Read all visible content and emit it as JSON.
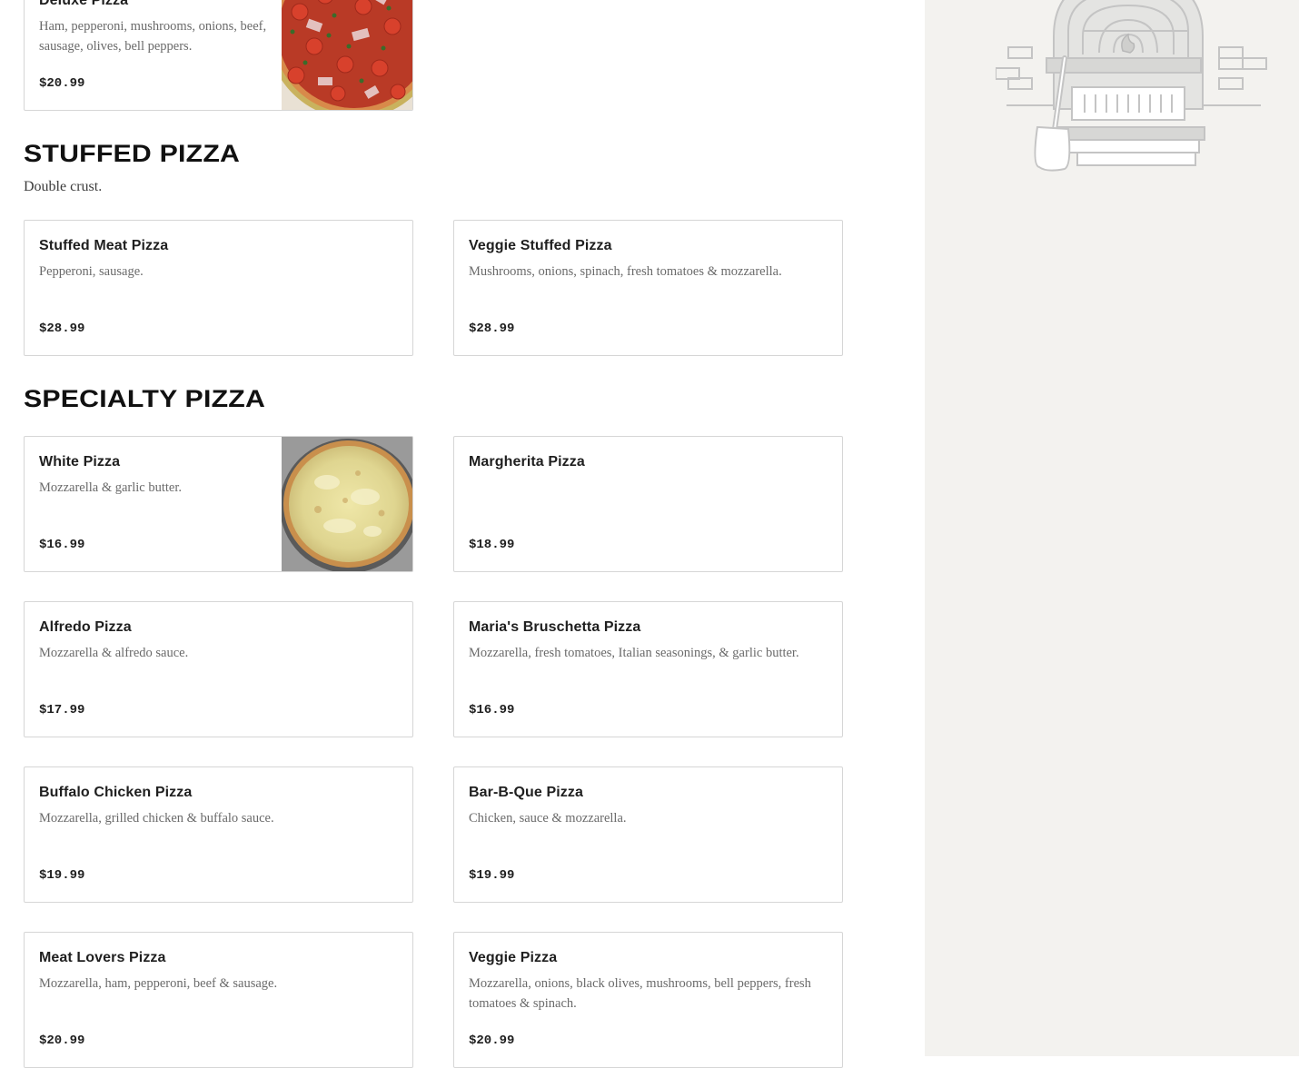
{
  "menu": {
    "deluxe_card": {
      "name": "Deluxe Pizza",
      "description": "Ham, pepperoni, mushrooms, onions, beef, sausage, olives, bell peppers.",
      "price": "$20.99",
      "image_icon": "pepperoni-pizza-photo"
    },
    "stuffed": {
      "title": "STUFFED PIZZA",
      "subtitle": "Double crust.",
      "items": [
        {
          "name": "Stuffed Meat Pizza",
          "description": "Pepperoni, sausage.",
          "price": "$28.99"
        },
        {
          "name": "Veggie Stuffed Pizza",
          "description": "Mushrooms, onions, spinach, fresh tomatoes & mozzarella.",
          "price": "$28.99"
        }
      ]
    },
    "specialty": {
      "title": "SPECIALTY PIZZA",
      "items": [
        {
          "name": "White Pizza",
          "description": "Mozzarella & garlic butter.",
          "price": "$16.99",
          "image_icon": "white-pizza-photo"
        },
        {
          "name": "Margherita Pizza",
          "description": "",
          "price": "$18.99"
        },
        {
          "name": "Alfredo Pizza",
          "description": "Mozzarella & alfredo sauce.",
          "price": "$17.99"
        },
        {
          "name": "Maria's Bruschetta Pizza",
          "description": "Mozzarella, fresh tomatoes, Italian seasonings, & garlic butter.",
          "price": "$16.99"
        },
        {
          "name": "Buffalo Chicken Pizza",
          "description": "Mozzarella, grilled chicken & buffalo sauce.",
          "price": "$19.99"
        },
        {
          "name": "Bar-B-Que Pizza",
          "description": "Chicken, sauce & mozzarella.",
          "price": "$19.99"
        },
        {
          "name": "Meat Lovers Pizza",
          "description": "Mozzarella, ham, pepperoni, beef & sausage.",
          "price": "$20.99"
        },
        {
          "name": "Veggie Pizza",
          "description": "Mozzarella, onions, black olives, mushrooms, bell peppers, fresh tomatoes & spinach.",
          "price": "$20.99"
        }
      ]
    }
  },
  "sidebar": {
    "illustration_icon": "pizza-oven-icon"
  },
  "colors": {
    "sidebar_background": "#f3f2ef",
    "card_border": "#d6d6d6",
    "title_text": "#111111",
    "description_text": "#6a6a6a",
    "illustration_stroke": "#c4c4c4"
  }
}
